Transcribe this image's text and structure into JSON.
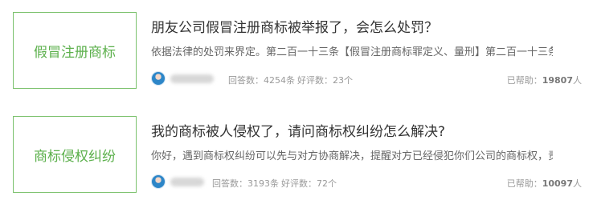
{
  "items": [
    {
      "thumb_label": "假冒注册商标",
      "title": "朋友公司假冒注册商标被举报了，会怎么处罚？",
      "excerpt": "依据法律的处罚来界定。第二百一十三条【假冒注册商标罪定义、量刑】第二百一十三条未...",
      "answers": "回答数：4254条",
      "rating": "好评数：23个",
      "helped_prefix": "已帮助：",
      "helped_count": "19807",
      "helped_suffix": "人"
    },
    {
      "thumb_label": "商标侵权纠纷",
      "title": "我的商标被人侵权了，请问商标权纠纷怎么解决?",
      "excerpt": "你好，遇到商标权纠纷可以先与对方协商解决，提醒对方已经侵犯你们公司的商标权，责令...",
      "answers": "回答数：3193条",
      "rating": "好评数：72个",
      "helped_prefix": "已帮助：",
      "helped_count": "10097",
      "helped_suffix": "人"
    }
  ],
  "colors": {
    "accent": "#5cb04c",
    "border": "#7cc26e"
  },
  "icons": {
    "avatar": "lawyer-avatar"
  }
}
